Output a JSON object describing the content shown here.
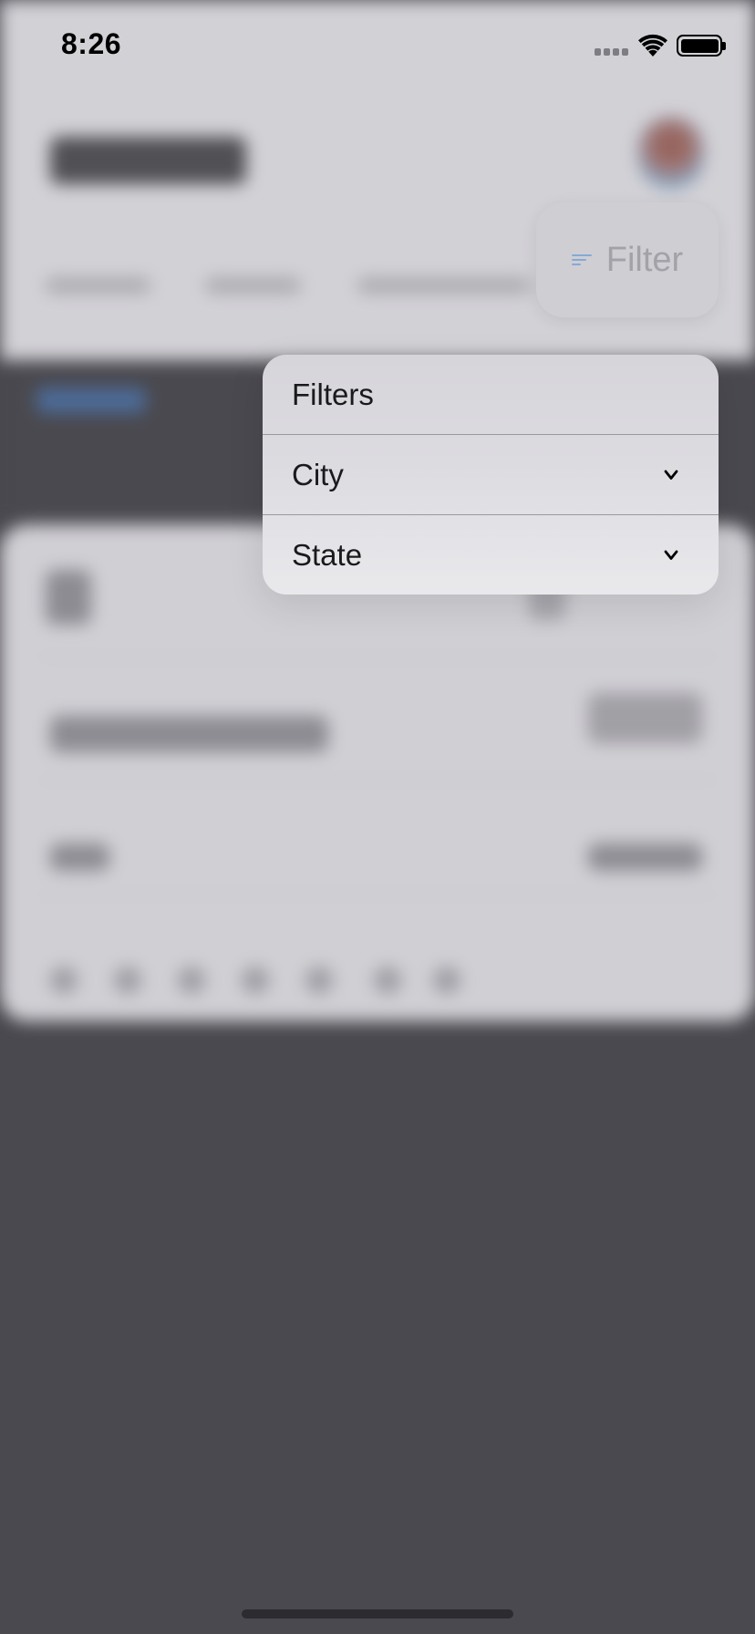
{
  "status_bar": {
    "time": "8:26",
    "icons": [
      "cellular-signal-icon",
      "wifi-icon",
      "battery-icon"
    ]
  },
  "filter_button": {
    "label": "Filter",
    "icon": "filter-lines-icon",
    "icon_color": "#86a9d6",
    "label_color": "#a3a2a8"
  },
  "menu": {
    "header": "Filters",
    "items": [
      {
        "label": "City",
        "icon": "chevron-down-icon"
      },
      {
        "label": "State",
        "icon": "chevron-down-icon"
      }
    ]
  },
  "colors": {
    "background_dim": "#4a494f",
    "background_light": "#d2d1d6",
    "menu_background": "#dcdbe0"
  }
}
